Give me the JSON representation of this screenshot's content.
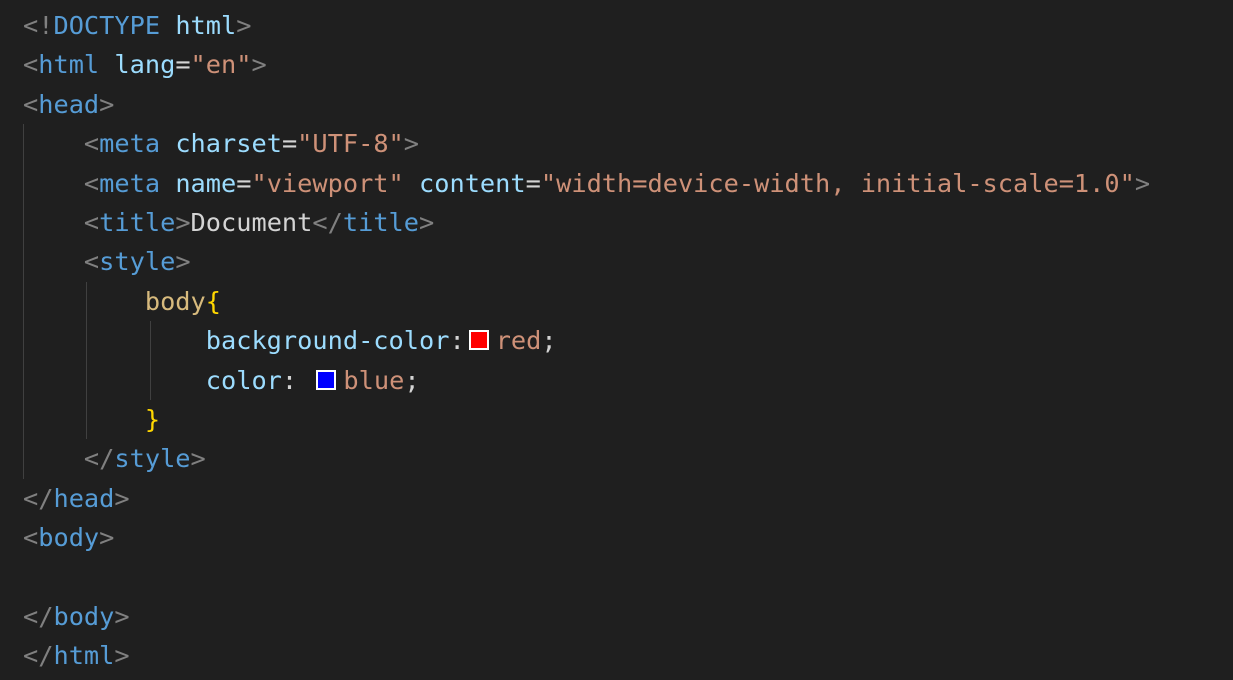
{
  "colors": {
    "background": "#1f1f1f",
    "punctuation": "#808080",
    "tag": "#569cd6",
    "attribute": "#9cdcfe",
    "string": "#ce9178",
    "text": "#d4d4d4",
    "selector": "#d7ba7d",
    "brace": "#ffd700",
    "guide": "#404040"
  },
  "lines": [
    {
      "indent": 0,
      "guides": [],
      "tokens": [
        {
          "t": "<!",
          "c": "punct"
        },
        {
          "t": "DOCTYPE",
          "c": "tag"
        },
        {
          "t": " ",
          "c": "text"
        },
        {
          "t": "html",
          "c": "attr"
        },
        {
          "t": ">",
          "c": "punct"
        }
      ]
    },
    {
      "indent": 0,
      "guides": [],
      "tokens": [
        {
          "t": "<",
          "c": "punct"
        },
        {
          "t": "html",
          "c": "tag"
        },
        {
          "t": " ",
          "c": "text"
        },
        {
          "t": "lang",
          "c": "attr"
        },
        {
          "t": "=",
          "c": "text"
        },
        {
          "t": "\"en\"",
          "c": "str"
        },
        {
          "t": ">",
          "c": "punct"
        }
      ]
    },
    {
      "indent": 0,
      "guides": [],
      "tokens": [
        {
          "t": "<",
          "c": "punct"
        },
        {
          "t": "head",
          "c": "tag"
        },
        {
          "t": ">",
          "c": "punct"
        }
      ]
    },
    {
      "indent": 4,
      "guides": [
        0
      ],
      "tokens": [
        {
          "t": "<",
          "c": "punct"
        },
        {
          "t": "meta",
          "c": "tag"
        },
        {
          "t": " ",
          "c": "text"
        },
        {
          "t": "charset",
          "c": "attr"
        },
        {
          "t": "=",
          "c": "text"
        },
        {
          "t": "\"UTF-8\"",
          "c": "str"
        },
        {
          "t": ">",
          "c": "punct"
        }
      ]
    },
    {
      "indent": 4,
      "guides": [
        0
      ],
      "tokens": [
        {
          "t": "<",
          "c": "punct"
        },
        {
          "t": "meta",
          "c": "tag"
        },
        {
          "t": " ",
          "c": "text"
        },
        {
          "t": "name",
          "c": "attr"
        },
        {
          "t": "=",
          "c": "text"
        },
        {
          "t": "\"viewport\"",
          "c": "str"
        },
        {
          "t": " ",
          "c": "text"
        },
        {
          "t": "content",
          "c": "attr"
        },
        {
          "t": "=",
          "c": "text"
        },
        {
          "t": "\"width=device-width, initial-scale=1.0\"",
          "c": "str"
        },
        {
          "t": ">",
          "c": "punct"
        }
      ]
    },
    {
      "indent": 4,
      "guides": [
        0
      ],
      "tokens": [
        {
          "t": "<",
          "c": "punct"
        },
        {
          "t": "title",
          "c": "tag"
        },
        {
          "t": ">",
          "c": "punct"
        },
        {
          "t": "Document",
          "c": "text"
        },
        {
          "t": "</",
          "c": "punct"
        },
        {
          "t": "title",
          "c": "tag"
        },
        {
          "t": ">",
          "c": "punct"
        }
      ]
    },
    {
      "indent": 4,
      "guides": [
        0
      ],
      "tokens": [
        {
          "t": "<",
          "c": "punct"
        },
        {
          "t": "style",
          "c": "tag"
        },
        {
          "t": ">",
          "c": "punct"
        }
      ]
    },
    {
      "indent": 8,
      "guides": [
        0,
        4
      ],
      "tokens": [
        {
          "t": "body",
          "c": "sel"
        },
        {
          "t": "{",
          "c": "brace"
        }
      ]
    },
    {
      "indent": 12,
      "guides": [
        0,
        4,
        8
      ],
      "tokens": [
        {
          "t": "background-color",
          "c": "prop"
        },
        {
          "t": ":",
          "c": "text"
        },
        {
          "swatch": "#ff0000"
        },
        {
          "t": "red",
          "c": "val"
        },
        {
          "t": ";",
          "c": "text"
        }
      ]
    },
    {
      "indent": 12,
      "guides": [
        0,
        4,
        8
      ],
      "tokens": [
        {
          "t": "color",
          "c": "prop"
        },
        {
          "t": ": ",
          "c": "text"
        },
        {
          "swatch": "#0000ff"
        },
        {
          "t": "blue",
          "c": "val"
        },
        {
          "t": ";",
          "c": "text"
        }
      ]
    },
    {
      "indent": 8,
      "guides": [
        0,
        4
      ],
      "tokens": [
        {
          "t": "}",
          "c": "brace"
        }
      ]
    },
    {
      "indent": 4,
      "guides": [
        0
      ],
      "tokens": [
        {
          "t": "</",
          "c": "punct"
        },
        {
          "t": "style",
          "c": "tag"
        },
        {
          "t": ">",
          "c": "punct"
        }
      ]
    },
    {
      "indent": 0,
      "guides": [],
      "tokens": [
        {
          "t": "</",
          "c": "punct"
        },
        {
          "t": "head",
          "c": "tag"
        },
        {
          "t": ">",
          "c": "punct"
        }
      ]
    },
    {
      "indent": 0,
      "guides": [],
      "tokens": [
        {
          "t": "<",
          "c": "punct"
        },
        {
          "t": "body",
          "c": "tag"
        },
        {
          "t": ">",
          "c": "punct"
        }
      ]
    },
    {
      "indent": 0,
      "guides": [],
      "tokens": []
    },
    {
      "indent": 0,
      "guides": [],
      "tokens": [
        {
          "t": "</",
          "c": "punct"
        },
        {
          "t": "body",
          "c": "tag"
        },
        {
          "t": ">",
          "c": "punct"
        }
      ]
    },
    {
      "indent": 0,
      "guides": [],
      "tokens": [
        {
          "t": "</",
          "c": "punct"
        },
        {
          "t": "html",
          "c": "tag"
        },
        {
          "t": ">",
          "c": "punct"
        }
      ]
    }
  ]
}
